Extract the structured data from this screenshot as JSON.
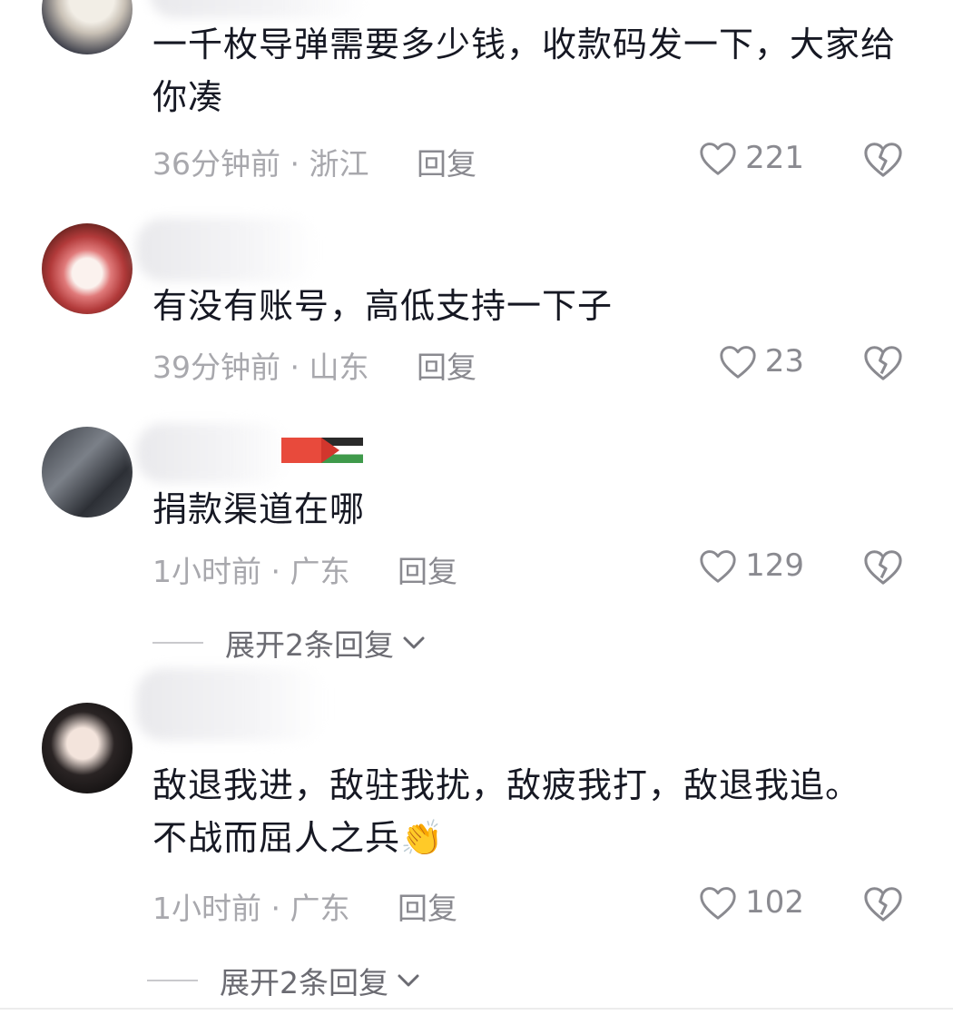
{
  "comments": [
    {
      "text": "一千枚导弹需要多少钱，收款码发一下，大家给你凑",
      "time": "36分钟前",
      "location": "浙江",
      "reply_label": "回复",
      "likes": "221"
    },
    {
      "text": "有没有账号，高低支持一下子",
      "time": "39分钟前",
      "location": "山东",
      "reply_label": "回复",
      "likes": "23"
    },
    {
      "text": "捐款渠道在哪",
      "time": "1小时前",
      "location": "广东",
      "reply_label": "回复",
      "likes": "129",
      "expand_label": "展开2条回复"
    },
    {
      "text_line1": "敌退我进，敌驻我扰，敌疲我打，敌退我追。",
      "text_line2": "不战而屈人之兵",
      "emoji": "👏",
      "time": "1小时前",
      "location": "广东",
      "reply_label": "回复",
      "likes": "102",
      "expand_label": "展开2条回复"
    }
  ],
  "separator": "·",
  "icons": {
    "like": "heart-outline-icon",
    "dislike": "broken-heart-icon",
    "expand": "chevron-down-icon"
  }
}
